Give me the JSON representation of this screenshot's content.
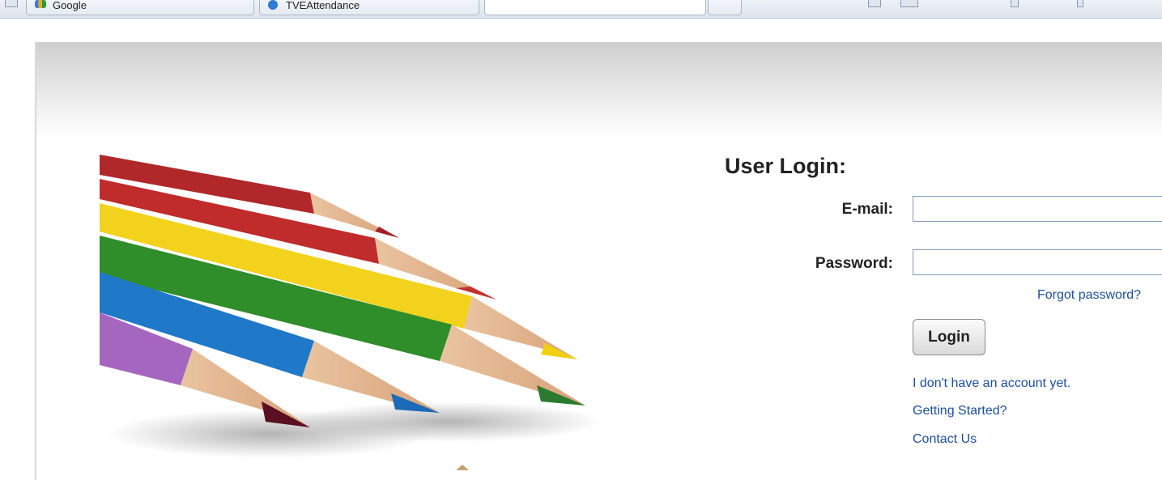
{
  "browser": {
    "tabs": [
      {
        "label": "Google",
        "icon": "google-icon"
      },
      {
        "label": "TVEAttendance",
        "icon": "ie-icon"
      }
    ]
  },
  "login": {
    "title": "User Login:",
    "email_label": "E-mail:",
    "email_value": "",
    "password_label": "Password:",
    "password_value": "",
    "forgot_label": "Forgot password?",
    "login_button": "Login",
    "links": [
      "I don't have an account yet.",
      "Getting Started?",
      "Contact Us"
    ]
  },
  "colors": {
    "link": "#1c4f9c",
    "banner_top": "#cfcfcf"
  }
}
